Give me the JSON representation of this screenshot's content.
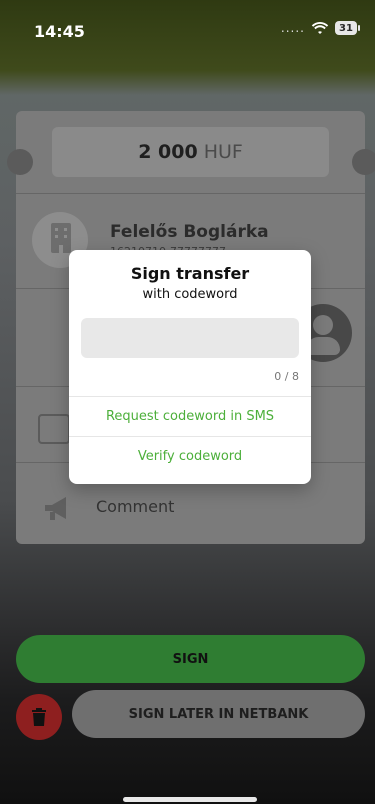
{
  "status_bar": {
    "time": "14:45",
    "signal": ".....",
    "battery": "31"
  },
  "transfer": {
    "amount": "2 000",
    "currency": "HUF",
    "beneficiary_name": "Felelős Boglárka",
    "beneficiary_account": "16210710-77777777",
    "comment_label": "Comment"
  },
  "modal": {
    "title": "Sign transfer",
    "subtitle": "with codeword",
    "input_value": "",
    "counter": "0 / 8",
    "request_sms": "Request codeword in SMS",
    "verify": "Verify codeword"
  },
  "actions": {
    "sign": "SIGN",
    "sign_later": "SIGN LATER IN NETBANK"
  },
  "colors": {
    "accent_green": "#4caf3a",
    "danger_red": "#8e1f1f"
  }
}
